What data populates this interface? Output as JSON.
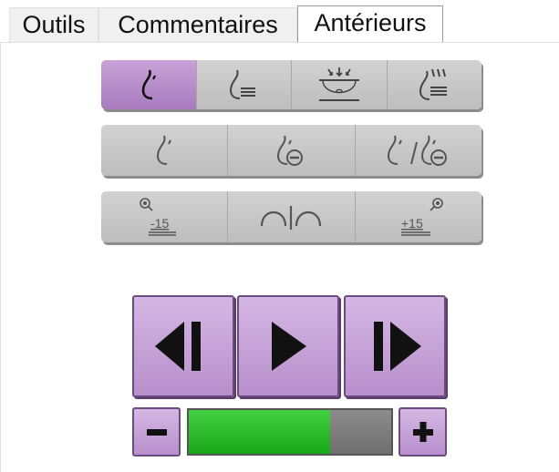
{
  "tabs": [
    {
      "label": "Outils"
    },
    {
      "label": "Commentaires"
    },
    {
      "label": "Antérieurs",
      "active": true
    }
  ],
  "mode_strip": {
    "items": [
      {
        "icon": "breast-icon",
        "selected": true
      },
      {
        "icon": "breast-with-lines-icon"
      },
      {
        "icon": "compression-paddle-icon"
      },
      {
        "icon": "breast-slices-icon"
      }
    ]
  },
  "view_strip": {
    "items": [
      {
        "icon": "breast-icon"
      },
      {
        "icon": "breast-minus-icon"
      },
      {
        "icon": "breast-split-minus-icon"
      }
    ]
  },
  "angle_strip": {
    "items": [
      {
        "icon": "angle-minus-icon",
        "label": "-15"
      },
      {
        "icon": "split-arc-icon"
      },
      {
        "icon": "angle-plus-icon",
        "label": "+15"
      }
    ]
  },
  "cine": {
    "previous": {
      "icon": "step-back-icon"
    },
    "play": {
      "icon": "play-icon"
    },
    "next": {
      "icon": "step-forward-icon"
    }
  },
  "speed": {
    "minus_icon": "minus-icon",
    "plus_icon": "plus-icon",
    "value_fraction": 0.7
  },
  "colors": {
    "accent_purple": "#b88fcc",
    "selected_purple": "#a77bbd",
    "slider_green": "#22b822",
    "button_gray": "#c6c6c6"
  }
}
